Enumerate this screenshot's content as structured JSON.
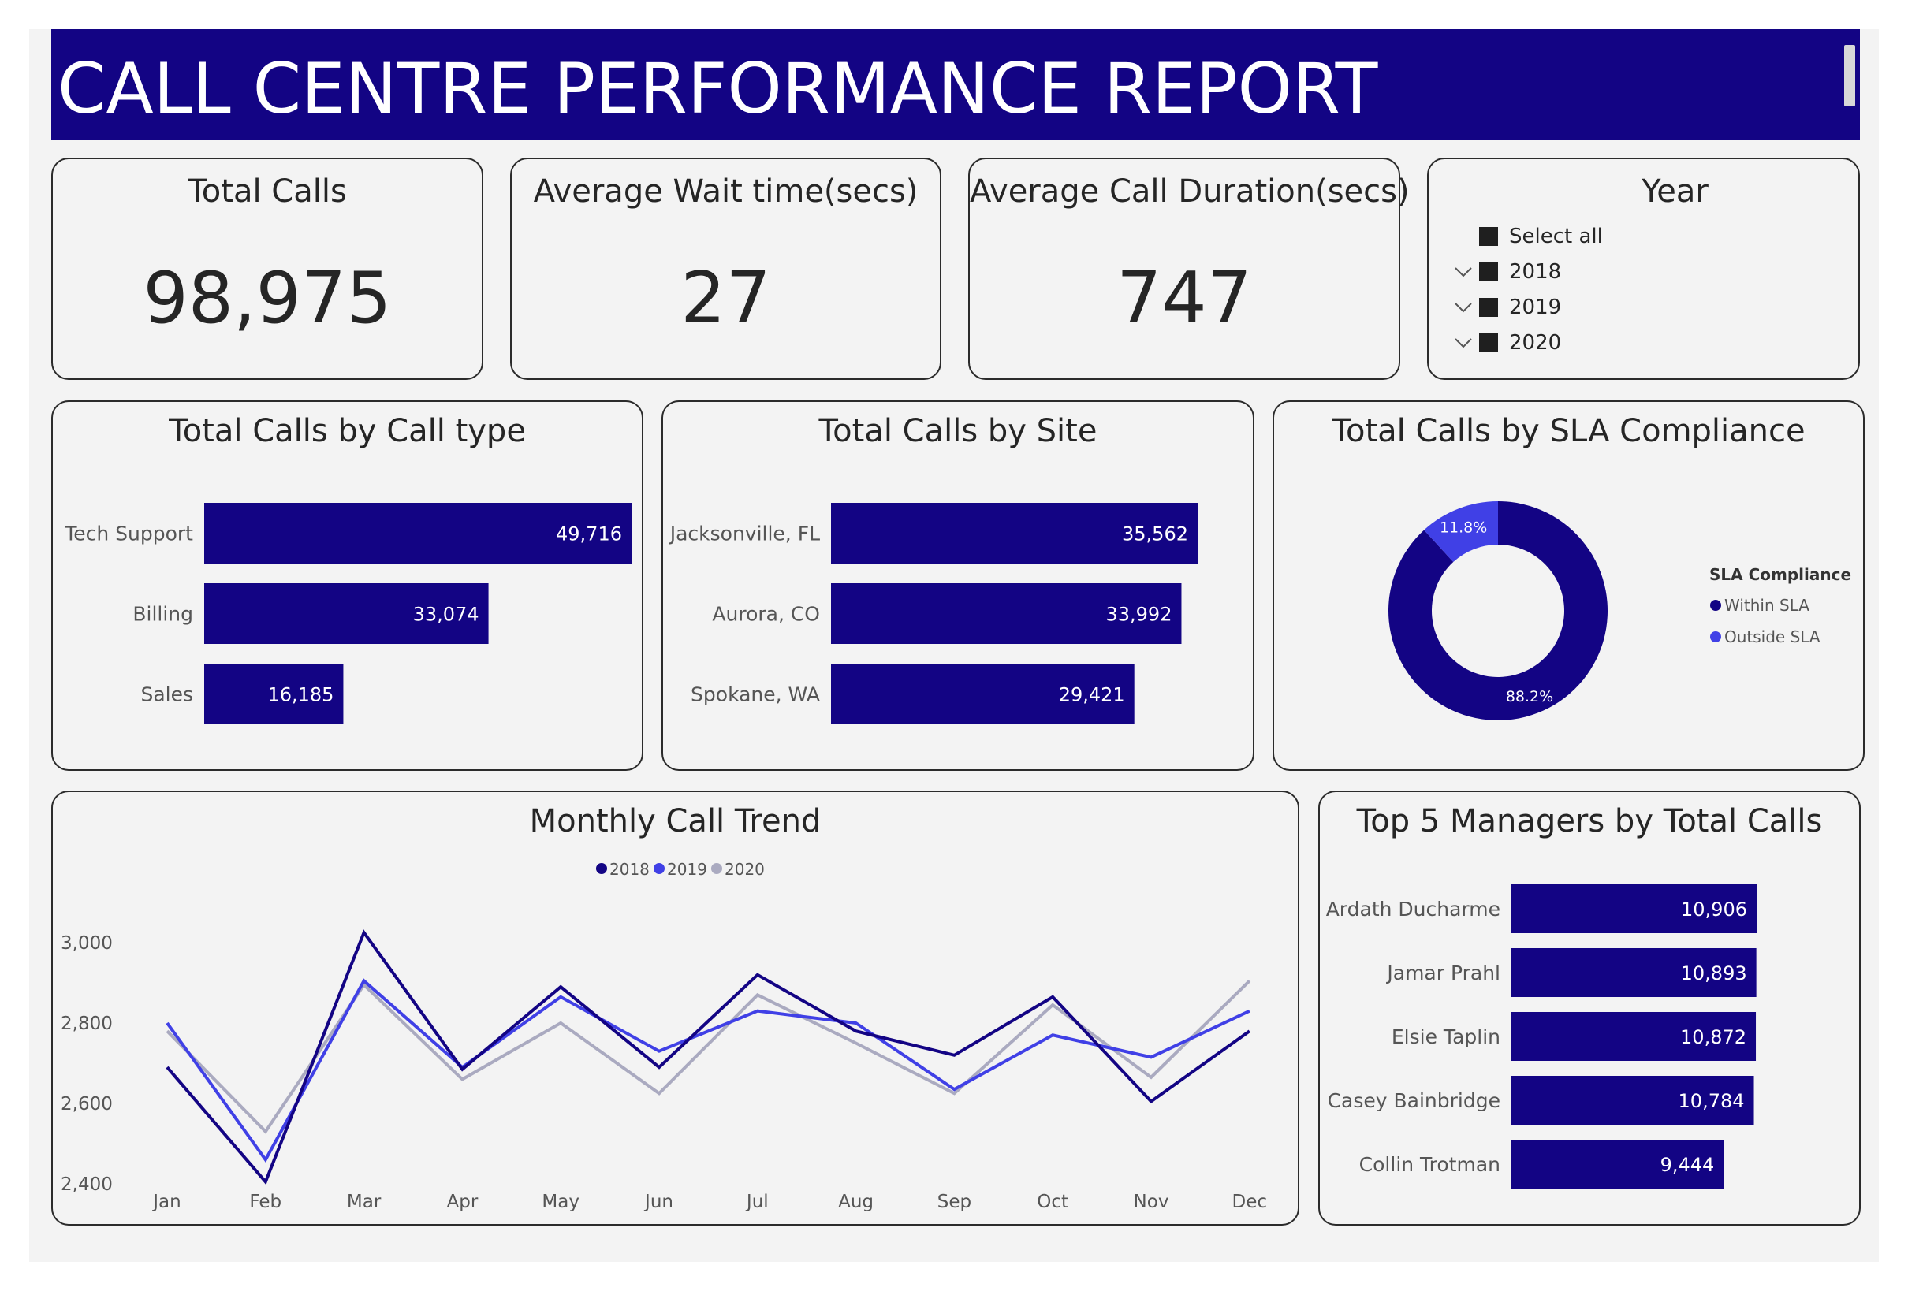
{
  "report": {
    "title": "CALL CENTRE PERFORMANCE REPORT"
  },
  "kpis": [
    {
      "label": "Total Calls",
      "value": "98,975"
    },
    {
      "label": "Average Wait time(secs)",
      "value": "27"
    },
    {
      "label": "Average Call Duration(secs)",
      "value": "747"
    }
  ],
  "year_slicer": {
    "title": "Year",
    "items": [
      {
        "label": "Select all",
        "expandable": false
      },
      {
        "label": "2018",
        "expandable": true
      },
      {
        "label": "2019",
        "expandable": true
      },
      {
        "label": "2020",
        "expandable": true
      }
    ]
  },
  "colors": {
    "primary": "#130484",
    "secondary": "#4040e6",
    "tertiary": "#aaaac0"
  },
  "chart_data": [
    {
      "id": "call_type",
      "type": "bar",
      "orientation": "horizontal",
      "title": "Total Calls by Call type",
      "categories": [
        "Tech Support",
        "Billing",
        "Sales"
      ],
      "values": [
        49716,
        33074,
        16185
      ],
      "value_labels": [
        "49,716",
        "33,074",
        "16,185"
      ]
    },
    {
      "id": "site",
      "type": "bar",
      "orientation": "horizontal",
      "title": "Total Calls by Site",
      "categories": [
        "Jacksonville, FL",
        "Aurora, CO",
        "Spokane, WA"
      ],
      "values": [
        35562,
        33992,
        29421
      ],
      "value_labels": [
        "35,562",
        "33,992",
        "29,421"
      ]
    },
    {
      "id": "sla",
      "type": "pie",
      "variant": "donut",
      "title": "Total Calls by SLA Compliance",
      "legend_title": "SLA Compliance",
      "legend_position": "right",
      "slices": [
        {
          "name": "Within SLA",
          "value": 88.2,
          "label": "88.2%",
          "color": "#130484"
        },
        {
          "name": "Outside SLA",
          "value": 11.8,
          "label": "11.8%",
          "color": "#4040e6"
        }
      ]
    },
    {
      "id": "monthly",
      "type": "line",
      "title": "Monthly Call Trend",
      "legend_position": "top-center",
      "categories": [
        "Jan",
        "Feb",
        "Mar",
        "Apr",
        "May",
        "Jun",
        "Jul",
        "Aug",
        "Sep",
        "Oct",
        "Nov",
        "Dec"
      ],
      "ylim": [
        2400,
        3000
      ],
      "yticks": [
        2400,
        2600,
        2800,
        3000
      ],
      "ytick_labels": [
        "2,400",
        "2,600",
        "2,800",
        "3,000"
      ],
      "series": [
        {
          "name": "2018",
          "color": "#130484",
          "values": [
            2690,
            2405,
            3025,
            2685,
            2890,
            2690,
            2920,
            2780,
            2720,
            2865,
            2605,
            2780
          ]
        },
        {
          "name": "2019",
          "color": "#4040e6",
          "values": [
            2800,
            2460,
            2905,
            2690,
            2865,
            2730,
            2830,
            2800,
            2635,
            2770,
            2715,
            2830
          ]
        },
        {
          "name": "2020",
          "color": "#aaaac0",
          "values": [
            2780,
            2530,
            2895,
            2660,
            2800,
            2625,
            2870,
            2750,
            2625,
            2845,
            2665,
            2905
          ]
        }
      ]
    },
    {
      "id": "managers",
      "type": "bar",
      "orientation": "horizontal",
      "title": "Top 5 Managers by Total Calls",
      "categories": [
        "Ardath Ducharme",
        "Jamar Prahl",
        "Elsie Taplin",
        "Casey Bainbridge",
        "Collin Trotman"
      ],
      "values": [
        10906,
        10893,
        10872,
        10784,
        9444
      ],
      "value_labels": [
        "10,906",
        "10,893",
        "10,872",
        "10,784",
        "9,444"
      ]
    }
  ]
}
